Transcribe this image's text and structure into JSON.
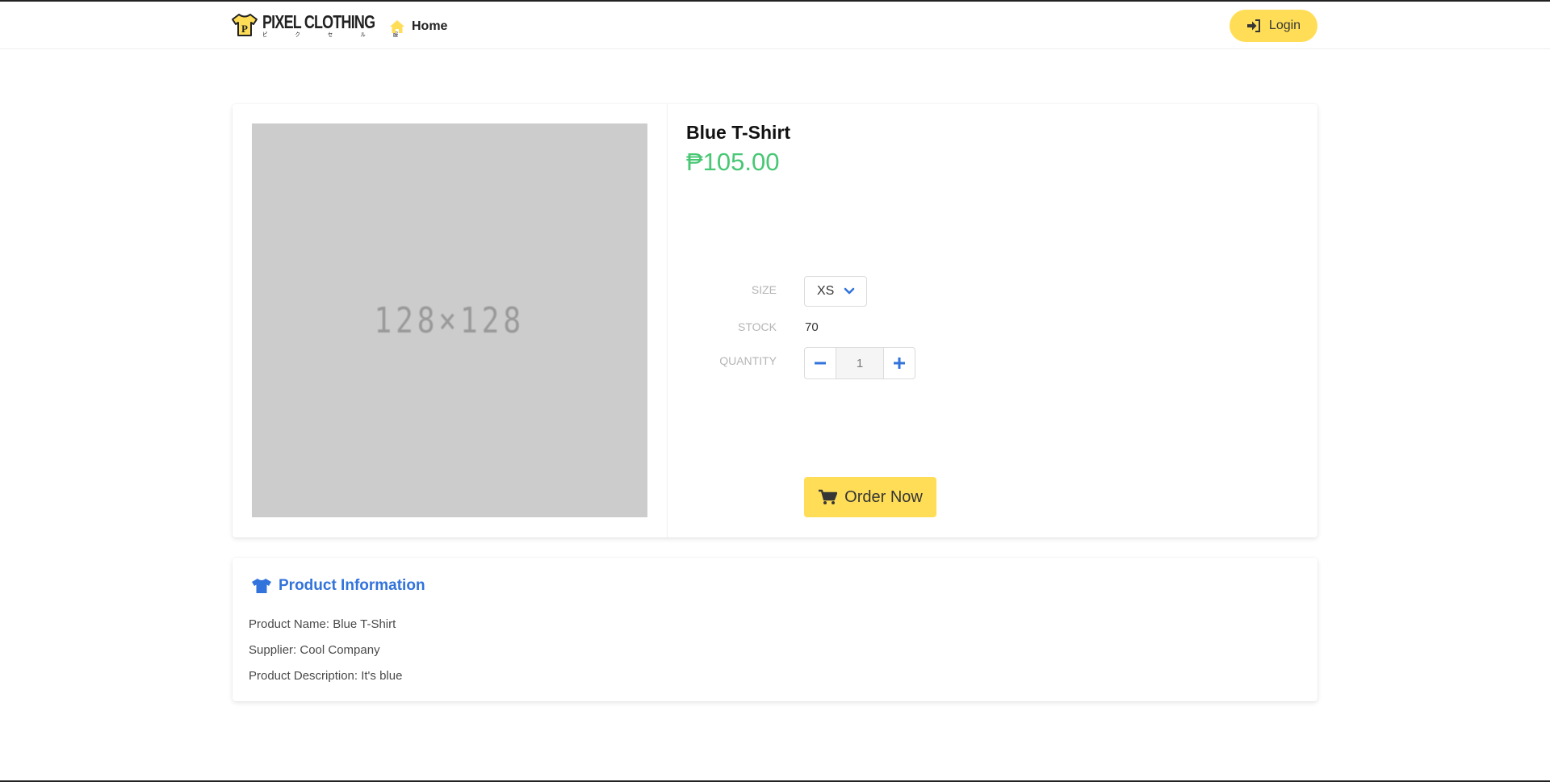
{
  "brand": {
    "name": "PIXEL CLOTHING",
    "subtitle": "ピ ク セ ル 服"
  },
  "nav": {
    "home_label": "Home",
    "login_label": "Login"
  },
  "product": {
    "image_placeholder": "128×128",
    "name": "Blue T-Shirt",
    "price": "₱105.00",
    "size_label": "SIZE",
    "size_value": "XS",
    "stock_label": "STOCK",
    "stock_value": "70",
    "quantity_label": "QUANTITY",
    "quantity_value": "1",
    "order_label": "Order Now"
  },
  "info": {
    "title": "Product Information",
    "lines": [
      "Product Name: Blue T-Shirt",
      "Supplier: Cool Company",
      "Product Description: It's blue"
    ]
  },
  "colors": {
    "accent_yellow": "#ffdd57",
    "price_green": "#48c774",
    "link_blue": "#3273dc"
  }
}
